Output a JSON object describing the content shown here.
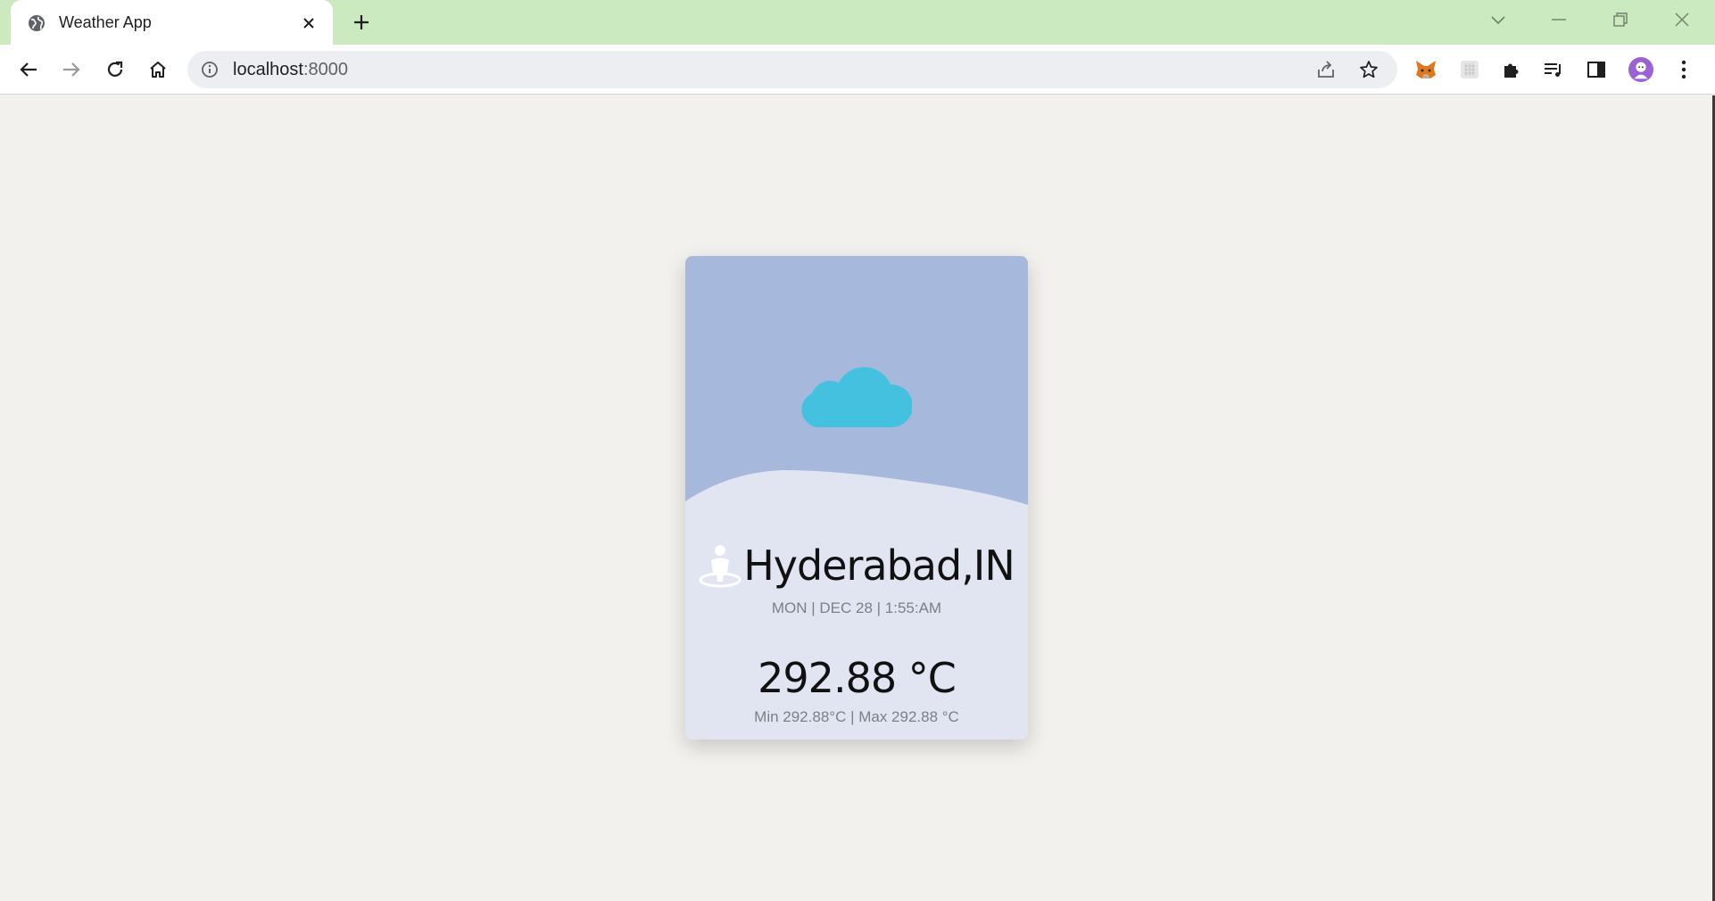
{
  "browser": {
    "tab_title": "Weather App",
    "url_host": "localhost",
    "url_port": ":8000",
    "colors": {
      "tabstrip": "#cbeac0",
      "omnibox": "#eceef1"
    }
  },
  "weather": {
    "city": "Hyderabad,IN",
    "datetime": "MON | DEC 28 | 1:55:AM",
    "temperature": "292.88 °C",
    "minmax": "Min 292.88°C | Max 292.88 °C",
    "icon": "cloud-icon",
    "colors": {
      "sky": "#a6b8dc",
      "card_bottom": "#e0e5f1",
      "cloud": "#45c1e0",
      "page_bg": "#f2f1ee"
    }
  }
}
